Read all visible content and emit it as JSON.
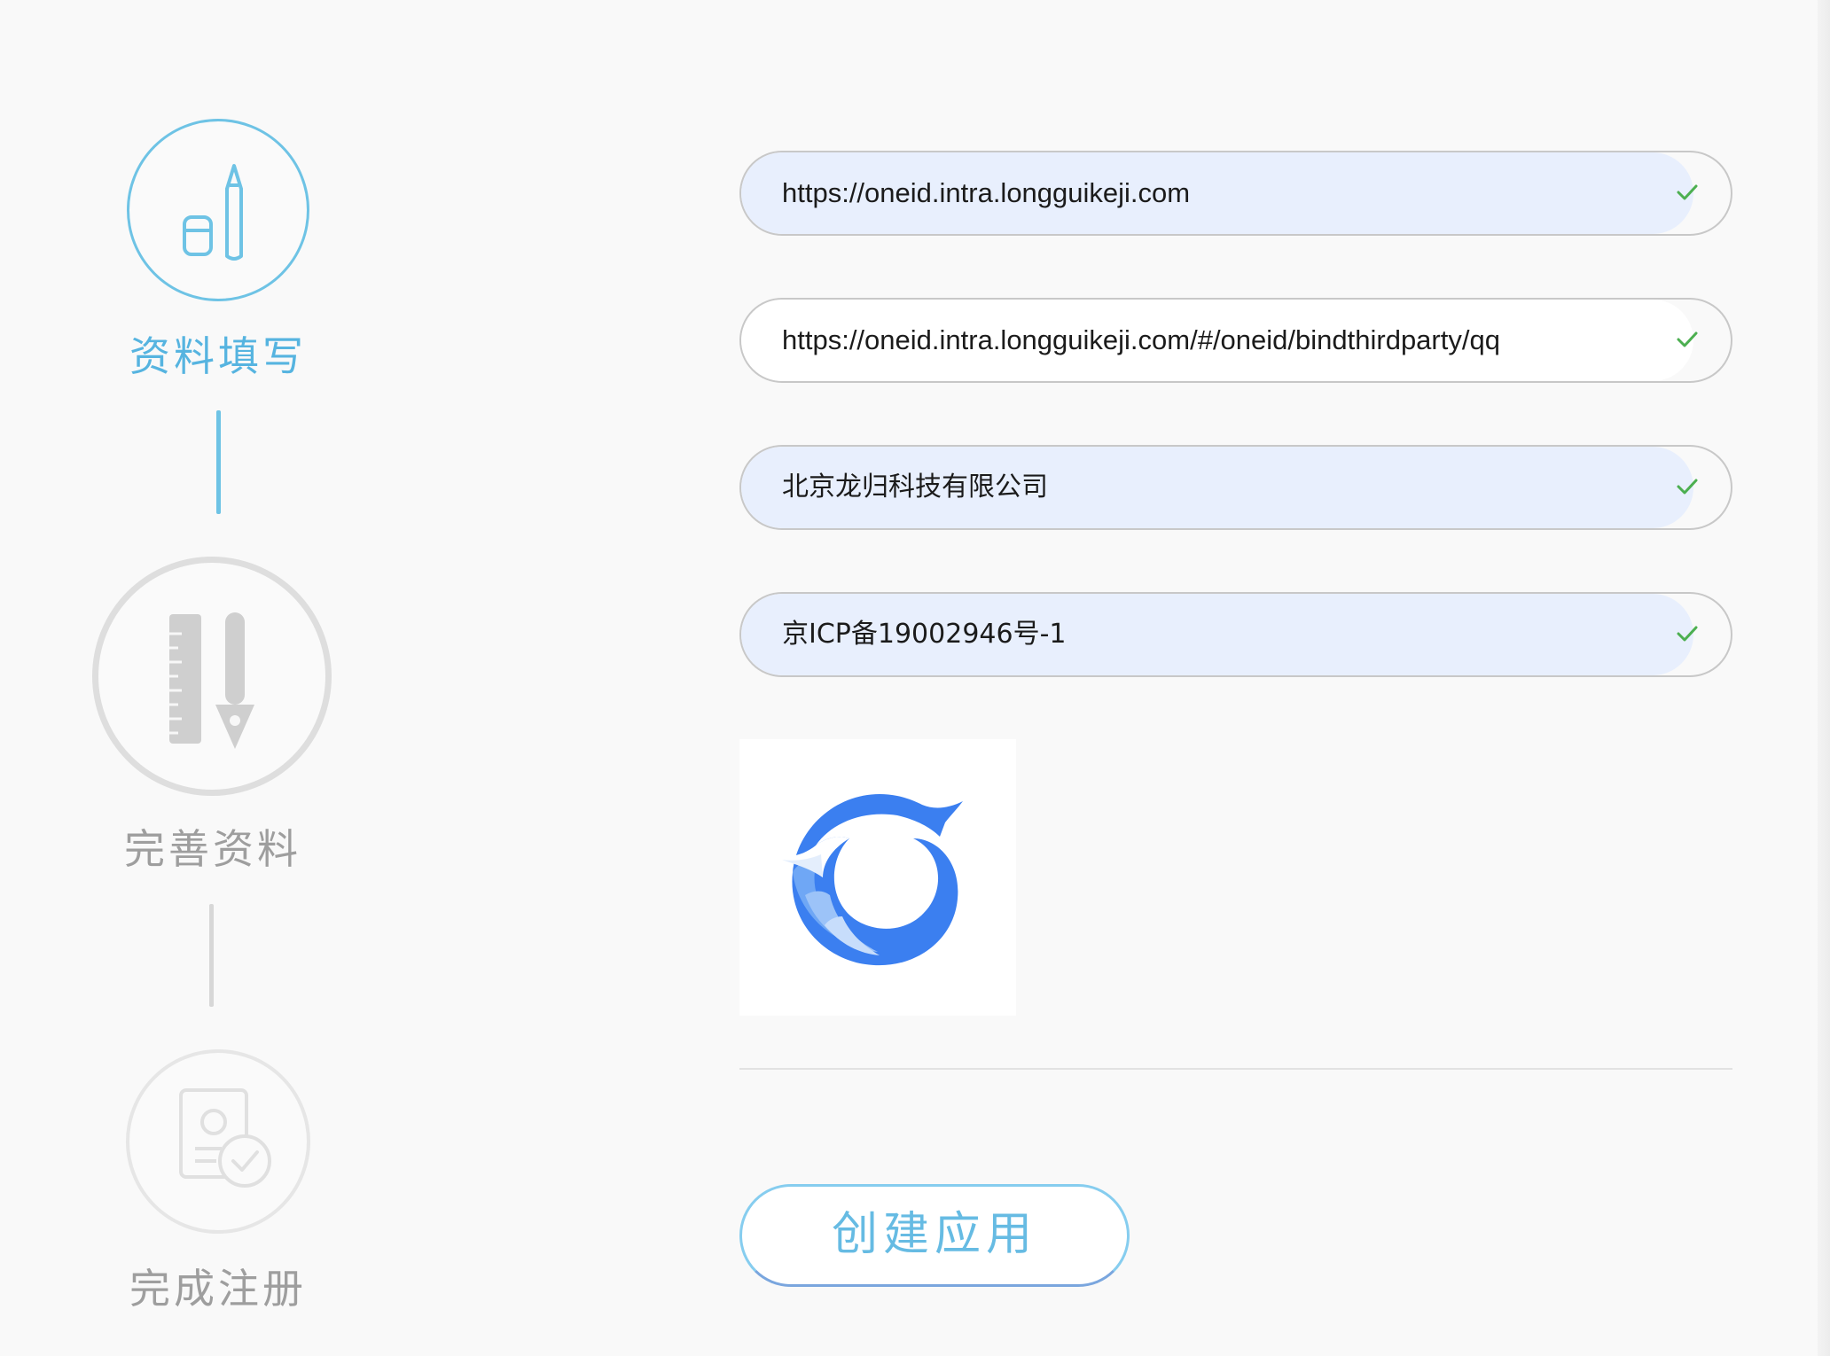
{
  "steps": [
    {
      "label": "资料填写",
      "state": "active",
      "icon": "pencil-eraser-icon"
    },
    {
      "label": "完善资料",
      "state": "pending",
      "icon": "ruler-pen-icon"
    },
    {
      "label": "完成注册",
      "state": "pending",
      "icon": "profile-check-icon"
    }
  ],
  "form": {
    "fields": [
      {
        "value": "https://oneid.intra.longguikeji.com",
        "valid": true
      },
      {
        "value": "https://oneid.intra.longguikeji.com/#/oneid/bindthirdparty/qq",
        "valid": true
      },
      {
        "value": "北京龙归科技有限公司",
        "valid": true
      },
      {
        "value": "京ICP备19002946号-1",
        "valid": true
      }
    ],
    "logo_icon": "app-logo-icon"
  },
  "actions": {
    "create_label": "创建应用"
  },
  "colors": {
    "accent": "#6ec3e5",
    "field_fill": "#e8effd",
    "check": "#4caf50",
    "inactive": "#9e9e9e",
    "logo_blue": "#3b7ff0"
  }
}
